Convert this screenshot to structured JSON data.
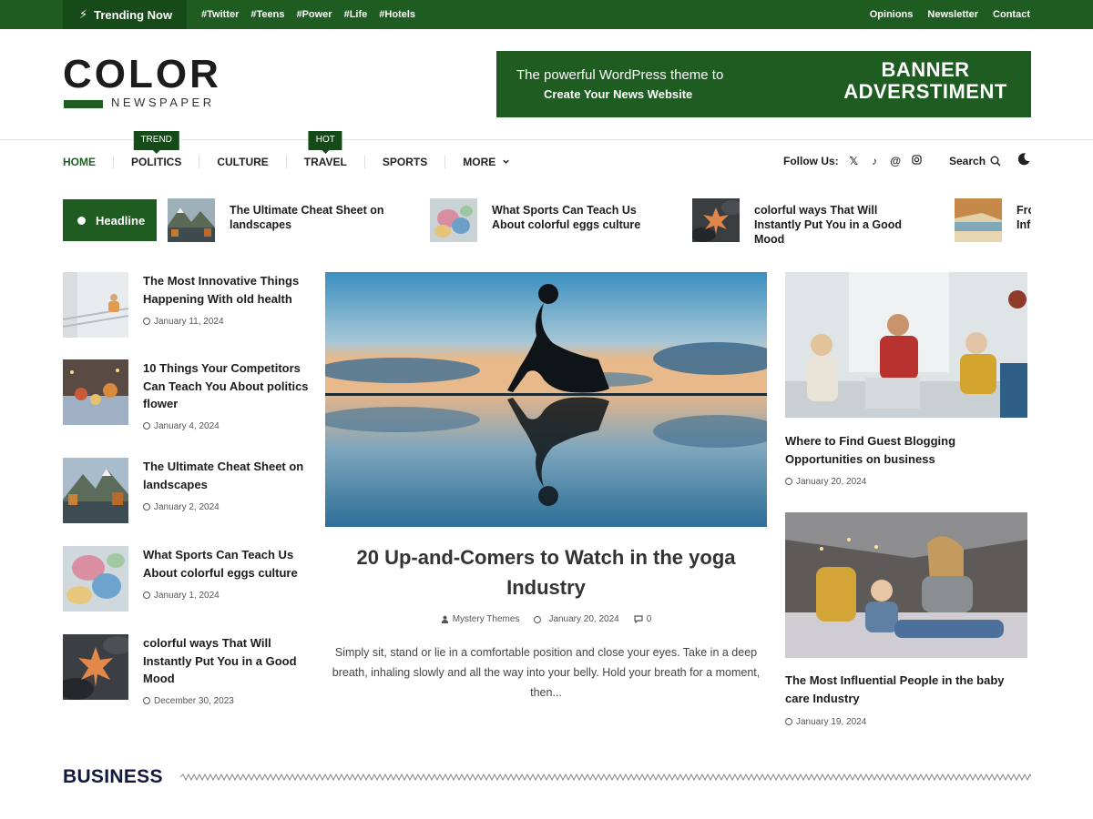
{
  "topbar": {
    "trending_label": "Trending Now",
    "tags": [
      "#Twitter",
      "#Teens",
      "#Power",
      "#Life",
      "#Hotels"
    ],
    "links": [
      "Opinions",
      "Newsletter",
      "Contact"
    ]
  },
  "logo": {
    "title": "COLOR",
    "subtitle": "NEWSPAPER"
  },
  "banner": {
    "line1": "The powerful WordPress theme to",
    "line2": "Create Your News Website",
    "right_line1": "BANNER",
    "right_line2": "ADVERSTIMENT"
  },
  "nav": {
    "items": [
      {
        "label": "HOME",
        "tag": ""
      },
      {
        "label": "POLITICS",
        "tag": "TREND"
      },
      {
        "label": "CULTURE",
        "tag": ""
      },
      {
        "label": "TRAVEL",
        "tag": "HOT"
      },
      {
        "label": "SPORTS",
        "tag": ""
      },
      {
        "label": "MORE",
        "tag": ""
      }
    ],
    "follow_label": "Follow Us:",
    "search_label": "Search"
  },
  "headline": {
    "label": "Headline",
    "items": [
      {
        "title": "The Ultimate Cheat Sheet on landscapes"
      },
      {
        "title": "What Sports Can Teach Us About colorful eggs culture"
      },
      {
        "title": "colorful ways That Will Instantly Put You in a Good Mood"
      },
      {
        "title": "Fro Inf"
      }
    ]
  },
  "left_posts": [
    {
      "title": "The Most Innovative Things Happening With old health",
      "date": "January 11, 2024"
    },
    {
      "title": "10 Things Your Competitors Can Teach You About politics flower",
      "date": "January 4, 2024"
    },
    {
      "title": "The Ultimate Cheat Sheet on landscapes",
      "date": "January 2, 2024"
    },
    {
      "title": "What Sports Can Teach Us About colorful eggs culture",
      "date": "January 1, 2024"
    },
    {
      "title": "colorful ways That Will Instantly Put You in a Good Mood",
      "date": "December 30, 2023"
    }
  ],
  "featured": {
    "title": "20 Up-and-Comers to Watch in the yoga Industry",
    "author": "Mystery Themes",
    "date": "January 20, 2024",
    "comments": "0",
    "excerpt": "Simply sit, stand or lie in a comfortable position and close your eyes. Take in a deep breath, inhaling slowly and all the way into your belly. Hold your breath for a moment, then..."
  },
  "right_posts": [
    {
      "title": "Where to Find Guest Blogging Opportunities on business",
      "date": "January 20, 2024"
    },
    {
      "title": "The Most Influential People in the baby care Industry",
      "date": "January 19, 2024"
    }
  ],
  "section": {
    "title": "BUSINESS"
  },
  "colors": {
    "brand_green": "#1f5c22",
    "dark_green": "#174a19",
    "section_navy": "#13193d"
  }
}
